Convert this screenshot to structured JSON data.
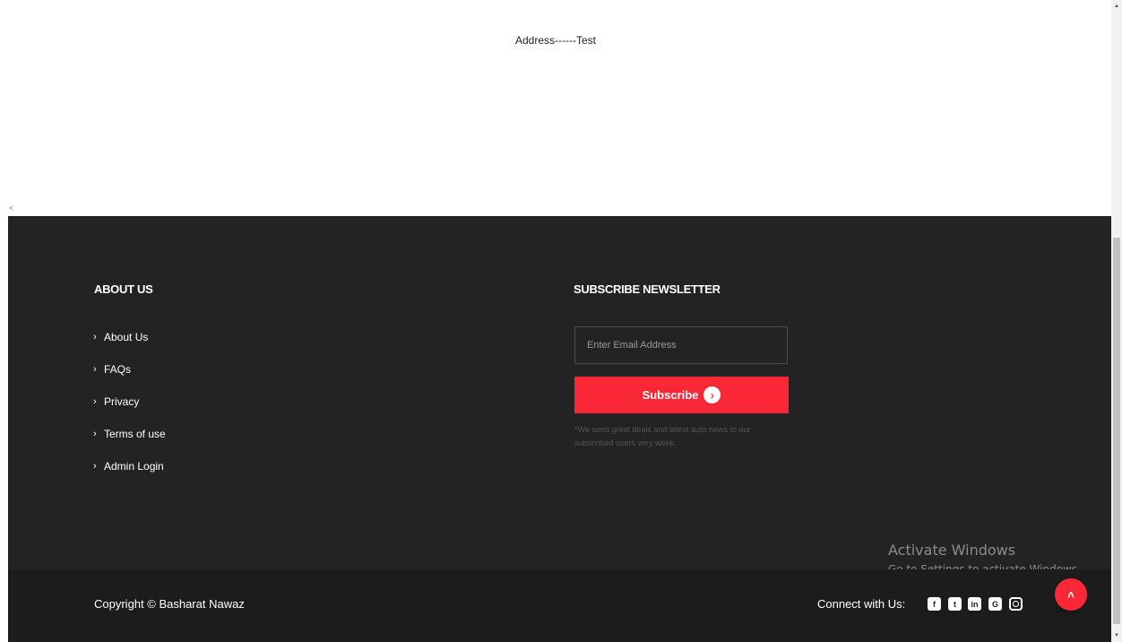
{
  "page": {
    "address_text": "Address------Test",
    "left_mark": "<"
  },
  "footer": {
    "about": {
      "heading": "ABOUT US",
      "links": [
        "About Us",
        "FAQs",
        "Privacy",
        "Terms of use",
        "Admin Login"
      ]
    },
    "newsletter": {
      "heading": "SUBSCRIBE NEWSLETTER",
      "email_placeholder": "Enter Email Address",
      "button_label": "Subscribe",
      "button_icon": "chevron-right-circle-icon",
      "note": "*We send great deals and latest auto news to our subscribed users very week."
    },
    "bottom": {
      "copyright": "Copyright © Basharat Nawaz",
      "connect_label": "Connect with Us:",
      "social_icons": [
        "facebook-icon",
        "twitter-icon",
        "linkedin-icon",
        "google-plus-icon",
        "instagram-icon"
      ]
    }
  },
  "watermark": {
    "line1": "Activate Windows",
    "line2": "Go to Settings to activate Windows."
  },
  "colors": {
    "footer_bg": "#232323",
    "footer_bottom_bg": "#1c1c1c",
    "accent": "#fa2837"
  }
}
